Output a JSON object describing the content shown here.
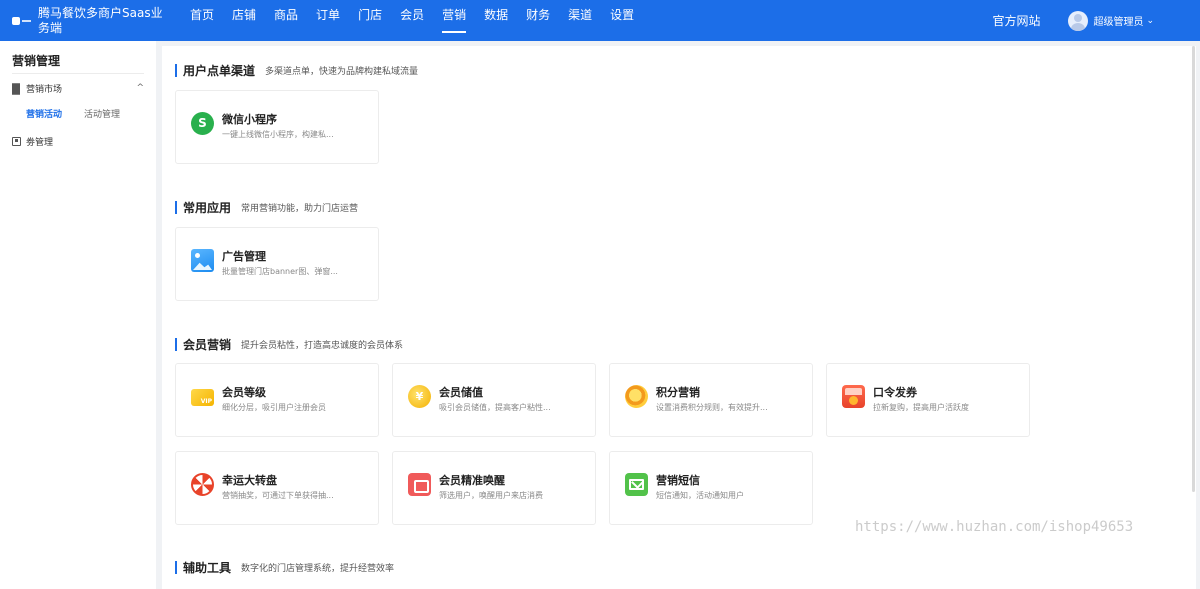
{
  "brand": {
    "title": "腾马餐饮多商户Saas业务端"
  },
  "nav": {
    "items": [
      "首页",
      "店铺",
      "商品",
      "订单",
      "门店",
      "会员",
      "营销",
      "数据",
      "财务",
      "渠道",
      "设置"
    ],
    "active_index": 6,
    "official_site": "官方网站",
    "user_name": "超级管理员",
    "accent_color": "#1c6ee8"
  },
  "sidebar": {
    "title": "营销管理",
    "groups": [
      {
        "label": "营销市场",
        "icon": "grid-icon",
        "expanded": true,
        "children": [
          "营销活动",
          "活动管理"
        ],
        "active_child": 0
      },
      {
        "label": "劵管理",
        "icon": "ticket-icon"
      }
    ]
  },
  "sections": [
    {
      "title": "用户点单渠道",
      "desc": "多渠道点单，快速为品牌构建私域流量",
      "cards": [
        {
          "title": "微信小程序",
          "desc": "一键上线微信小程序，构建私...",
          "icon": "wechat-miniprogram-icon"
        }
      ]
    },
    {
      "title": "常用应用",
      "desc": "常用营销功能，助力门店运营",
      "cards": [
        {
          "title": "广告管理",
          "desc": "批量管理门店banner图、弹窗...",
          "icon": "image-icon"
        }
      ]
    },
    {
      "title": "会员营销",
      "desc": "提升会员粘性，打造高忠诚度的会员体系",
      "cards": [
        {
          "title": "会员等级",
          "desc": "细化分层，吸引用户注册会员",
          "icon": "vip-card-icon"
        },
        {
          "title": "会员储值",
          "desc": "吸引会员储值，提高客户粘性...",
          "icon": "coin-icon"
        },
        {
          "title": "积分营销",
          "desc": "设置消费积分规则，有效提升...",
          "icon": "points-icon"
        },
        {
          "title": "口令发券",
          "desc": "拉新复购，提高用户活跃度",
          "icon": "coupon-code-icon"
        },
        {
          "title": "幸运大转盘",
          "desc": "营销抽奖，可通过下单获得抽...",
          "icon": "lucky-wheel-icon"
        },
        {
          "title": "会员精准唤醒",
          "desc": "筛选用户，唤醒用户来店消费",
          "icon": "wake-up-icon"
        },
        {
          "title": "营销短信",
          "desc": "短信通知，活动通知用户",
          "icon": "sms-icon"
        }
      ]
    },
    {
      "title": "辅助工具",
      "desc": "数字化的门店管理系统，提升经营效率",
      "cards": []
    }
  ],
  "watermark": "https://www.huzhan.com/ishop49653"
}
